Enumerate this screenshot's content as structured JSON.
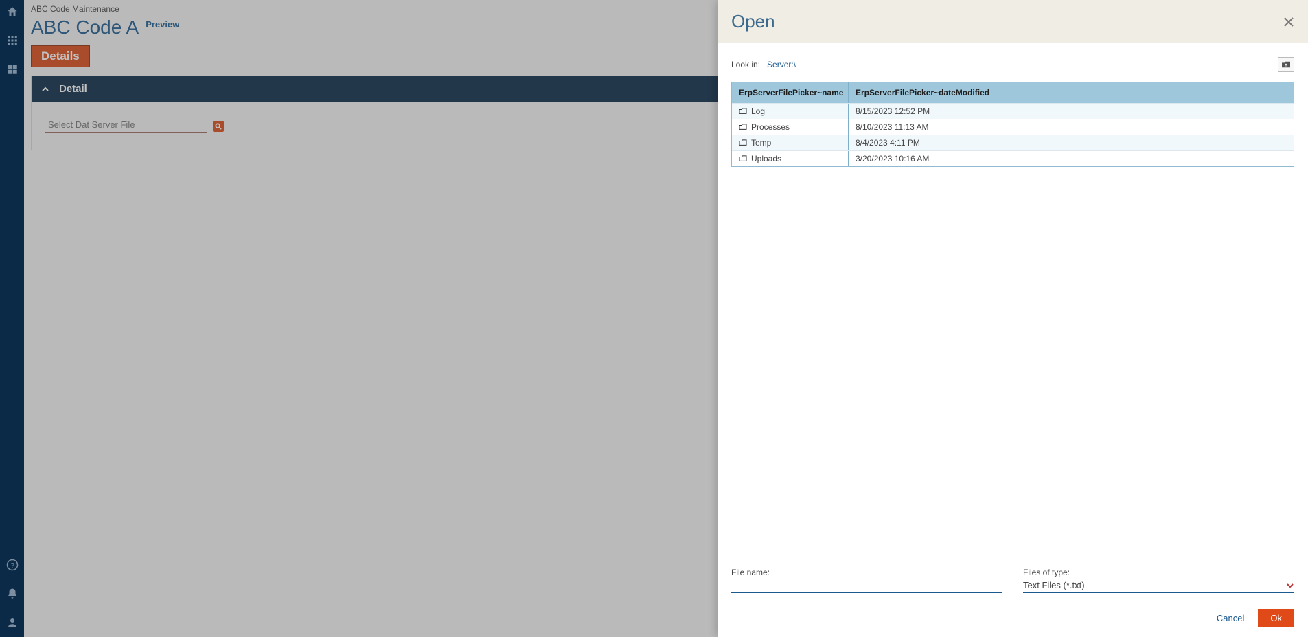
{
  "breadcrumb": "ABC Code Maintenance",
  "page_title": "ABC Code A",
  "preview_label": "Preview",
  "tab_details": "Details",
  "panel_title": "Detail",
  "field_placeholder": "Select Dat Server File",
  "modal": {
    "title": "Open",
    "lookin_label": "Look in:",
    "lookin_value": "Server:\\",
    "table": {
      "col_name": "ErpServerFilePicker~name",
      "col_date": "ErpServerFilePicker~dateModified",
      "rows": [
        {
          "name": "Log",
          "date": "8/15/2023 12:52 PM"
        },
        {
          "name": "Processes",
          "date": "8/10/2023 11:13 AM"
        },
        {
          "name": "Temp",
          "date": "8/4/2023 4:11 PM"
        },
        {
          "name": "Uploads",
          "date": "3/20/2023 10:16 AM"
        }
      ]
    },
    "file_name_label": "File name:",
    "file_type_label": "Files of type:",
    "file_type_value": "Text Files (*.txt)",
    "cancel": "Cancel",
    "ok": "Ok"
  }
}
